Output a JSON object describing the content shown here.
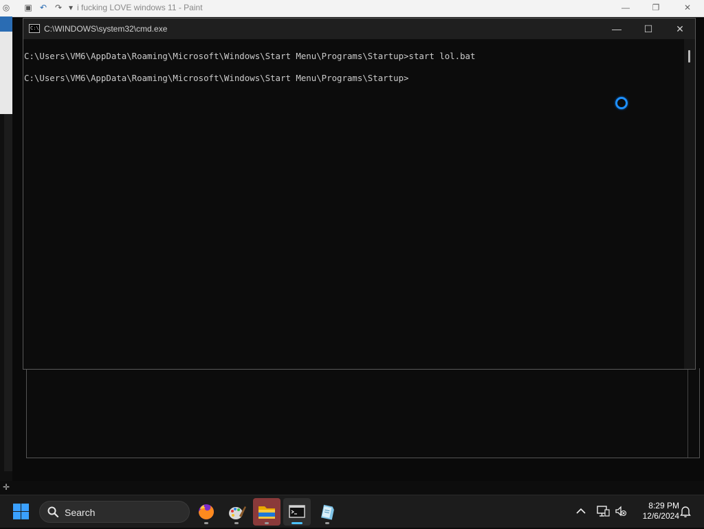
{
  "paint": {
    "title": "i fucking LOVE windows 11 - Paint"
  },
  "cmd": {
    "title": "C:\\WINDOWS\\system32\\cmd.exe",
    "minimize": "—",
    "maximize": "☐",
    "close": "✕",
    "lines": [
      "C:\\Users\\VM6\\AppData\\Roaming\\Microsoft\\Windows\\Start Menu\\Programs\\Startup>start lol.bat",
      "C:\\Users\\VM6\\AppData\\Roaming\\Microsoft\\Windows\\Start Menu\\Programs\\Startup>"
    ]
  },
  "taskbar": {
    "search_label": "Search",
    "apps": [
      {
        "name": "firefox"
      },
      {
        "name": "paint"
      },
      {
        "name": "file-explorer"
      },
      {
        "name": "command-prompt"
      },
      {
        "name": "notepad"
      }
    ],
    "time": "8:29 PM",
    "date": "12/6/2024"
  },
  "colors": {
    "accent": "#3aa0ff",
    "terminal_bg": "#0c0c0c",
    "terminal_text": "#cccccc",
    "spinner": "#1e90ff"
  }
}
